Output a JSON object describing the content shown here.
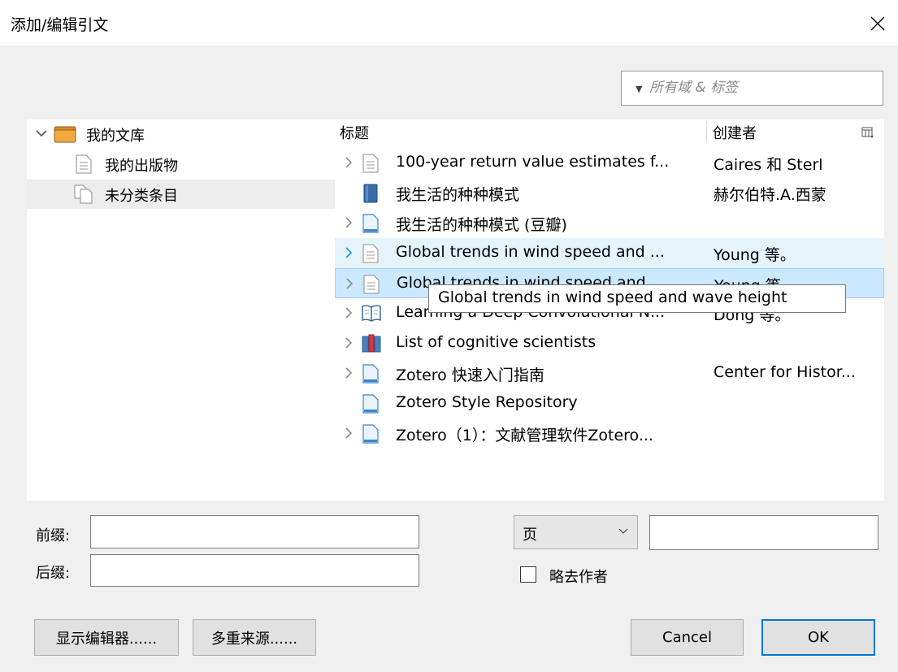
{
  "window": {
    "title": "添加/编辑引文"
  },
  "search": {
    "placeholder": "所有域 & 标签"
  },
  "tree": {
    "library_label": "我的文库",
    "items": [
      {
        "label": "我的出版物"
      },
      {
        "label": "未分类条目"
      }
    ]
  },
  "columns": {
    "title": "标题",
    "creator": "创建者"
  },
  "items": [
    {
      "title": "100-year return value estimates f...",
      "creator": "Caires 和 Sterl",
      "icon": "document-icon",
      "expandable": true
    },
    {
      "title": "我生活的种种模式",
      "creator": "赫尔伯特.A.西蒙",
      "icon": "book-icon",
      "expandable": false
    },
    {
      "title": "我生活的种种模式 (豆瓣)",
      "creator": "",
      "icon": "webpage-icon",
      "expandable": true
    },
    {
      "title": "Global trends in wind speed and ...",
      "creator": "Young 等。",
      "icon": "document-icon",
      "expandable": true
    },
    {
      "title": "Global trends in wind speed and ...",
      "creator": "Young 等。",
      "icon": "document-icon",
      "expandable": true
    },
    {
      "title": "Learning a Deep Convolutional N...",
      "creator": "Dong 等。",
      "icon": "book-section-icon",
      "expandable": true
    },
    {
      "title": "List of cognitive scientists",
      "creator": "",
      "icon": "encyclopedia-icon",
      "expandable": true
    },
    {
      "title": "Zotero 快速入门指南",
      "creator": "Center for Histor...",
      "icon": "webpage-icon",
      "expandable": true
    },
    {
      "title": "Zotero Style Repository",
      "creator": "",
      "icon": "webpage-icon",
      "expandable": false
    },
    {
      "title": "Zotero（1）：文献管理软件Zotero...",
      "creator": "",
      "icon": "webpage-icon",
      "expandable": true
    }
  ],
  "tooltip": {
    "text": "Global trends in wind speed and wave height"
  },
  "form": {
    "prefix_label": "前缀:",
    "suffix_label": "后缀:",
    "prefix_value": "",
    "suffix_value": "",
    "locator_type": "页",
    "locator_value": "",
    "omit_author_label": "略去作者",
    "omit_author_checked": false
  },
  "buttons": {
    "show_editor": "显示编辑器......",
    "multiple_sources": "多重来源......",
    "cancel": "Cancel",
    "ok": "OK"
  },
  "colors": {
    "dialog_bg": "#f0f0f0",
    "hover_row": "#e5f3fb",
    "selected_row": "#cce8ff",
    "accent": "#0078d7",
    "expander_active": "#1e9de8"
  }
}
